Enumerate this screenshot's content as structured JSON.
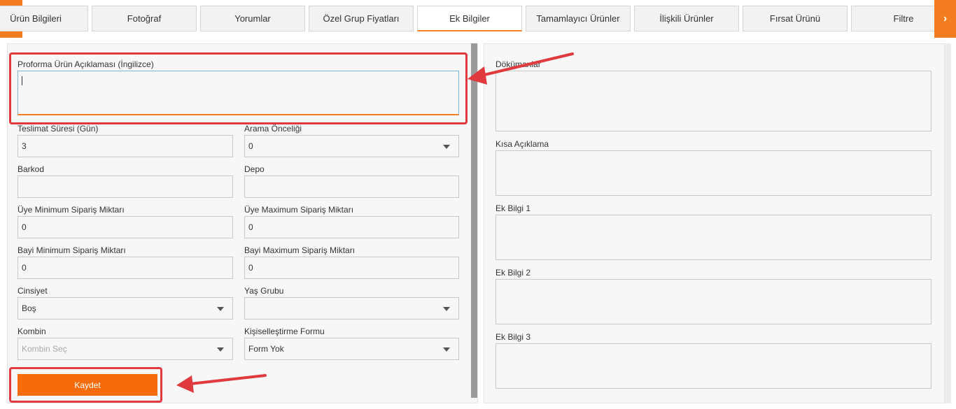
{
  "tabs": [
    "Ürün Bilgileri",
    "Fotoğraf",
    "Yorumlar",
    "Özel Grup Fiyatları",
    "Ek Bilgiler",
    "Tamamlayıcı Ürünler",
    "İlişkili Ürünler",
    "Fırsat Ürünü",
    "Filtre"
  ],
  "active_tab": "Ek Bilgiler",
  "nav": {
    "left": "‹",
    "right": "›"
  },
  "form_left": {
    "proforma_label": "Proforma Ürün Açıklaması (İngilizce)",
    "proforma_value": "",
    "teslimat_label": "Teslimat Süresi (Gün)",
    "teslimat_value": "3",
    "arama_label": "Arama Önceliği",
    "arama_value": "0",
    "barkod_label": "Barkod",
    "barkod_value": "",
    "depo_label": "Depo",
    "depo_value": "",
    "uye_min_label": "Üye Minimum Sipariş Miktarı",
    "uye_min_value": "0",
    "uye_max_label": "Üye Maximum Sipariş Miktarı",
    "uye_max_value": "0",
    "bayi_min_label": "Bayi Minimum Sipariş Miktarı",
    "bayi_min_value": "0",
    "bayi_max_label": "Bayi Maximum Sipariş Miktarı",
    "bayi_max_value": "0",
    "cinsiyet_label": "Cinsiyet",
    "cinsiyet_value": "Boş",
    "yas_label": "Yaş Grubu",
    "yas_value": "",
    "kombin_label": "Kombin",
    "kombin_placeholder": "Kombin Seç",
    "kisisel_label": "Kişiselleştirme Formu",
    "kisisel_value": "Form Yok",
    "save_label": "Kaydet"
  },
  "form_right": {
    "dokumanlar_label": "Dökümanlar",
    "kisa_label": "Kısa Açıklama",
    "ek1_label": "Ek Bilgi 1",
    "ek2_label": "Ek Bilgi 2",
    "ek3_label": "Ek Bilgi 3"
  },
  "colors": {
    "accent": "#f47c20",
    "annotation": "#e0393e"
  }
}
